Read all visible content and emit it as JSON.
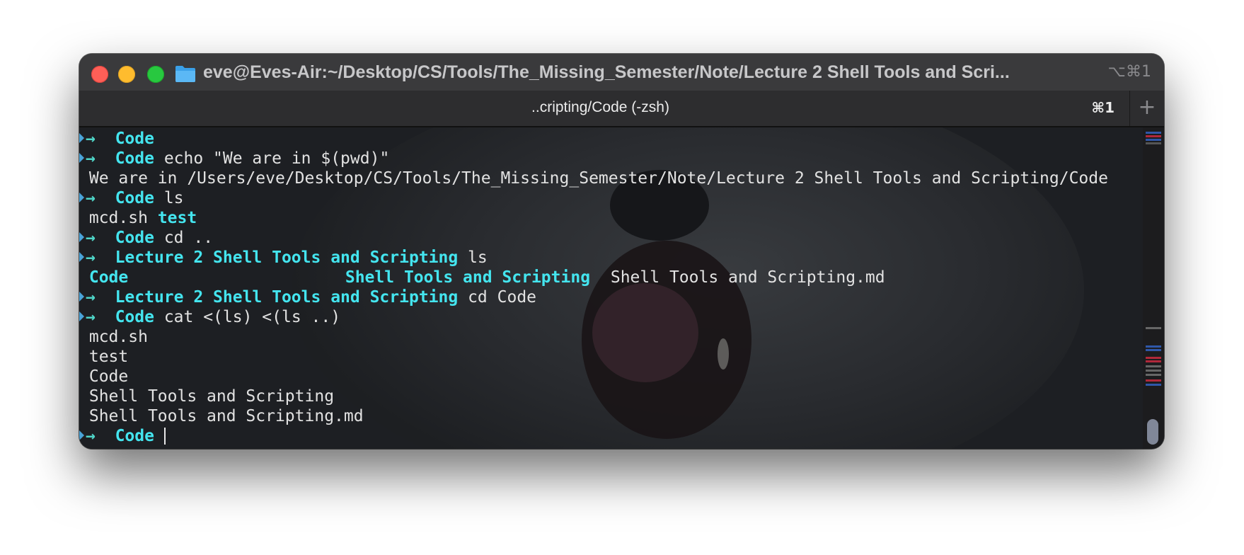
{
  "window": {
    "title": "eve@Eves-Air:~/Desktop/CS/Tools/The_Missing_Semester/Note/Lecture 2 Shell Tools and Scri...",
    "shortcut": "⌥⌘1"
  },
  "tab": {
    "title": "..cripting/Code (-zsh)",
    "shortcut": "⌘1",
    "add_label": "+"
  },
  "prompt_arrow": "→",
  "terminal": {
    "lines": [
      {
        "type": "prompt",
        "dir": "Code",
        "cmd": ""
      },
      {
        "type": "prompt",
        "dir": "Code",
        "cmd": "echo \"We are in $(pwd)\""
      },
      {
        "type": "output",
        "text": "We are in /Users/eve/Desktop/CS/Tools/The_Missing_Semester/Note/Lecture 2 Shell Tools and Scripting/Code"
      },
      {
        "type": "prompt",
        "dir": "Code",
        "cmd": "ls"
      },
      {
        "type": "ls1",
        "a": "mcd.sh",
        "b": "test"
      },
      {
        "type": "prompt",
        "dir": "Code",
        "cmd": "cd .."
      },
      {
        "type": "prompt",
        "dir": "Lecture 2 Shell Tools and Scripting",
        "cmd": "ls"
      },
      {
        "type": "ls2",
        "a": "Code",
        "b": "Shell Tools and Scripting",
        "c": "Shell Tools and Scripting.md"
      },
      {
        "type": "prompt",
        "dir": "Lecture 2 Shell Tools and Scripting",
        "cmd": "cd Code"
      },
      {
        "type": "prompt",
        "dir": "Code",
        "cmd": "cat <(ls) <(ls ..)"
      },
      {
        "type": "output",
        "text": "mcd.sh"
      },
      {
        "type": "output",
        "text": "test"
      },
      {
        "type": "output",
        "text": "Code"
      },
      {
        "type": "output",
        "text": "Shell Tools and Scripting"
      },
      {
        "type": "output",
        "text": "Shell Tools and Scripting.md"
      },
      {
        "type": "prompt",
        "dir": "Code",
        "cmd": "",
        "cursor": true
      }
    ]
  },
  "colors": {
    "arrow": "#4fd5c8",
    "directory": "#44e5ef",
    "text": "#e2e2e2",
    "background": "#1b1d20"
  },
  "icons": {
    "folder": "folder-icon",
    "add_tab": "plus-icon"
  }
}
